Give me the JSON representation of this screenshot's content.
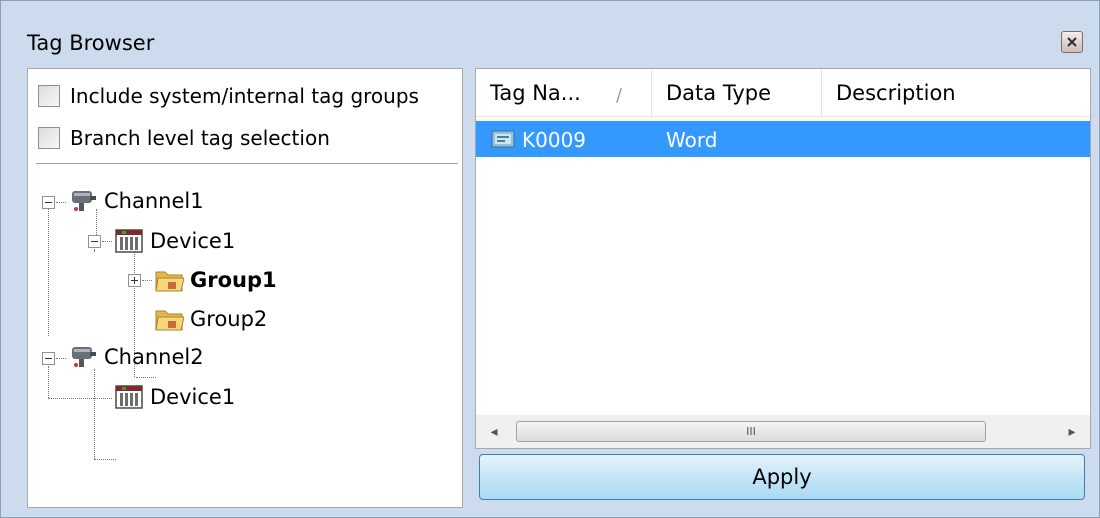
{
  "window": {
    "title": "Tag Browser"
  },
  "options": {
    "include_system": {
      "label": "Include system/internal tag groups",
      "checked": false
    },
    "branch_level": {
      "label": "Branch level tag selection",
      "checked": false
    }
  },
  "tree": {
    "channel1": {
      "label": "Channel1",
      "expanded": true
    },
    "device1a": {
      "label": "Device1",
      "expanded": true
    },
    "group1": {
      "label": "Group1",
      "expanded": false,
      "selected": true
    },
    "group2": {
      "label": "Group2"
    },
    "channel2": {
      "label": "Channel2",
      "expanded": true
    },
    "device1b": {
      "label": "Device1"
    }
  },
  "table": {
    "columns": [
      "Tag Na...",
      "Data Type",
      "Description"
    ],
    "sort_indicator": "/",
    "rows": [
      {
        "tag_name": "K0009",
        "data_type": "Word",
        "description": ""
      }
    ]
  },
  "scrollbar": {
    "left_arrow": "◂",
    "right_arrow": "▸",
    "grip": "III"
  },
  "buttons": {
    "apply": "Apply"
  },
  "colors": {
    "frame": "#ccdcee",
    "selection": "#3399ff",
    "button_border": "#3c7fb1"
  }
}
